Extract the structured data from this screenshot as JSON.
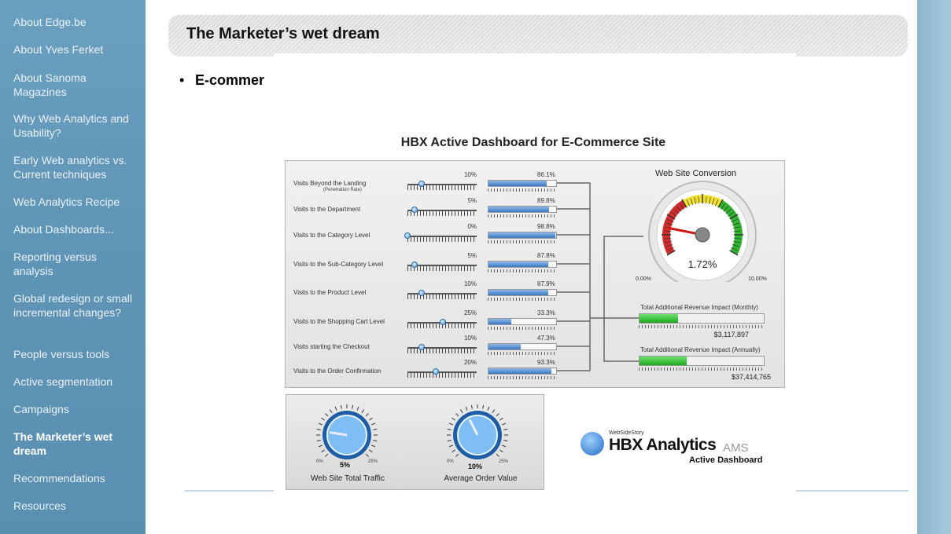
{
  "sidebar": {
    "items": [
      {
        "label": "About Edge.be"
      },
      {
        "label": "About Yves Ferket"
      },
      {
        "label": "About Sanoma Magazines"
      },
      {
        "label": "Why Web Analytics and Usability?"
      },
      {
        "label": "Early Web analytics vs. Current techniques"
      },
      {
        "label": "Web Analytics Recipe"
      },
      {
        "label": "About Dashboards..."
      },
      {
        "label": "Reporting versus analysis"
      },
      {
        "label": "Global redesign or small incremental changes?"
      },
      {
        "label": "People versus tools"
      },
      {
        "label": "Active segmentation"
      },
      {
        "label": "Campaigns"
      },
      {
        "label": "The Marketer’s wet dream",
        "active": true
      },
      {
        "label": "Recommendations"
      },
      {
        "label": "Resources"
      }
    ]
  },
  "slide": {
    "title": "The Marketer’s wet dream",
    "bullet_text": "E-commer"
  },
  "dashboard": {
    "title": "HBX Active Dashboard for E-Commerce Site",
    "rows": [
      {
        "label": "Visits Beyond the Landing",
        "sublabel": "(Penetration Rate)",
        "target_pct": "10%",
        "target": 10,
        "actual_pct": "86.1%",
        "actual": 86.1
      },
      {
        "label": "Visits to the Department",
        "sublabel": "",
        "target_pct": "5%",
        "target": 5,
        "actual_pct": "89.8%",
        "actual": 89.8
      },
      {
        "label": "Visits to the Category Level",
        "sublabel": "",
        "target_pct": "0%",
        "target": 0,
        "actual_pct": "98.8%",
        "actual": 98.8
      },
      {
        "label": "Visits to the Sub-Category Level",
        "sublabel": "",
        "target_pct": "5%",
        "target": 5,
        "actual_pct": "87.8%",
        "actual": 87.8
      },
      {
        "label": "Visits to the Product Level",
        "sublabel": "",
        "target_pct": "10%",
        "target": 10,
        "actual_pct": "87.9%",
        "actual": 87.9
      },
      {
        "label": "Visits to the Shopping Cart Level",
        "sublabel": "",
        "target_pct": "25%",
        "target": 25,
        "actual_pct": "33.3%",
        "actual": 33.3
      },
      {
        "label": "Visits starting the Checkout",
        "sublabel": "",
        "target_pct": "10%",
        "target": 10,
        "actual_pct": "47.3%",
        "actual": 47.3
      },
      {
        "label": "Visits to the Order Confirmation",
        "sublabel": "",
        "target_pct": "20%",
        "target": 20,
        "actual_pct": "93.3%",
        "actual": 93.3
      }
    ],
    "gauge": {
      "title": "Web Site Conversion",
      "value_label": "1.72%",
      "value": 1.72,
      "min_label": "0.00%",
      "max_label": "10.00%",
      "min": 0,
      "max": 10
    },
    "revenue": [
      {
        "label": "Total Additional Revenue Impact (Monthly)",
        "value": "$3,117,897",
        "fill": 0.31
      },
      {
        "label": "Total Additional Revenue Impact (Annually)",
        "value": "$37,414,765",
        "fill": 0.38
      }
    ],
    "knobs": [
      {
        "caption": "Web Site Total Traffic",
        "value_label": "5%",
        "min_label": "0%",
        "max_label": "25%",
        "value": 5,
        "max": 25
      },
      {
        "caption": "Average Order Value",
        "value_label": "10%",
        "min_label": "0%",
        "max_label": "25%",
        "value": 10,
        "max": 25
      }
    ],
    "logo": {
      "small": "WebSideStory",
      "brand": "HBX Analytics",
      "suffix": "AMS",
      "tagline": "Active Dashboard"
    }
  }
}
